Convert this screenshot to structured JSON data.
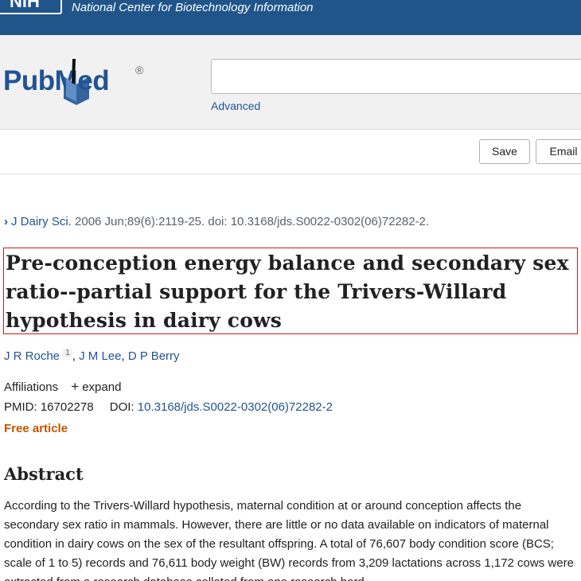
{
  "ncbi": {
    "logo_text": "NIH",
    "name": "National Center for Biotechnology Information"
  },
  "pubmed": {
    "logo_text": "PubMed",
    "registered": "®",
    "search_value": "",
    "advanced_label": "Advanced"
  },
  "actions": {
    "save_label": "Save",
    "email_label": "Email"
  },
  "article": {
    "journal": "J Dairy Sci.",
    "citation_rest": "2006 Jun;89(6):2119-25. doi: 10.3168/jds.S0022-0302(06)72282-2.",
    "title": "Pre-conception energy balance and secondary sex ratio--partial support for the Trivers-Willard hypothesis in dairy cows",
    "authors": [
      {
        "name": "J R Roche",
        "sup": "1"
      },
      {
        "name": "J M Lee"
      },
      {
        "name": "D P Berry"
      }
    ],
    "affiliations_label": "Affiliations",
    "expand_label": "expand",
    "pmid_label": "PMID:",
    "pmid": "16702278",
    "doi_label": "DOI:",
    "doi": "10.3168/jds.S0022-0302(06)72282-2",
    "free_label": "Free article"
  },
  "abstract": {
    "heading": "Abstract",
    "text": "According to the Trivers-Willard hypothesis, maternal condition at or around conception affects the secondary sex ratio in mammals. However, there are little or no data available on indicators of maternal condition in dairy cows on the sex of the resultant offspring. A total of 76,607 body condition score (BCS; scale of 1 to 5) records and 76,611 body weight (BW) records from 3,209 lactations across 1,172 cows were extracted from a research database collated from one research herd"
  },
  "colors": {
    "ncbi_bar": "#20558a",
    "link": "#205493",
    "free_article": "#c05600",
    "highlight_border": "#d01a1a"
  }
}
